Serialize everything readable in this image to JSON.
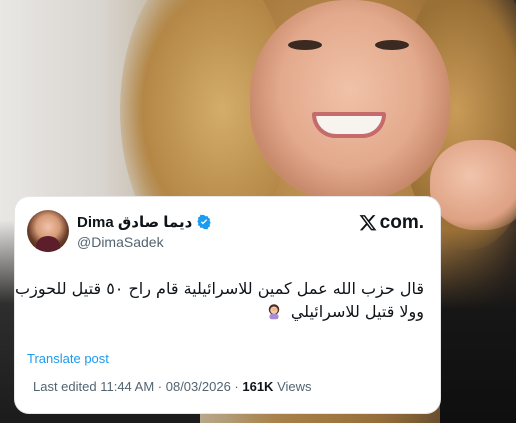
{
  "tweet": {
    "display_name": "Dima ديما صادق",
    "handle": "@DimaSadek",
    "source_label": "com.",
    "text_lines": [
      "قال حزب الله عمل كمين للاسرائيلية  قام راح ٥٠ قتيل للحوزب",
      "وولا قتيل للاسرائيلي"
    ],
    "translate_label": "Translate post",
    "edited_label": "Last edited 11:44 AM · 08/03/2026 ·",
    "views_count": "161K",
    "views_label": "Views"
  },
  "icons": {
    "verified": "verified-badge-icon",
    "x_logo": "x-logo-icon",
    "emoji": "woman-facepalming-emoji"
  },
  "colors": {
    "verified_blue": "#1d9bf0",
    "link_blue": "#1d9bf0",
    "text_primary": "#0f1419",
    "text_secondary": "#536471"
  }
}
